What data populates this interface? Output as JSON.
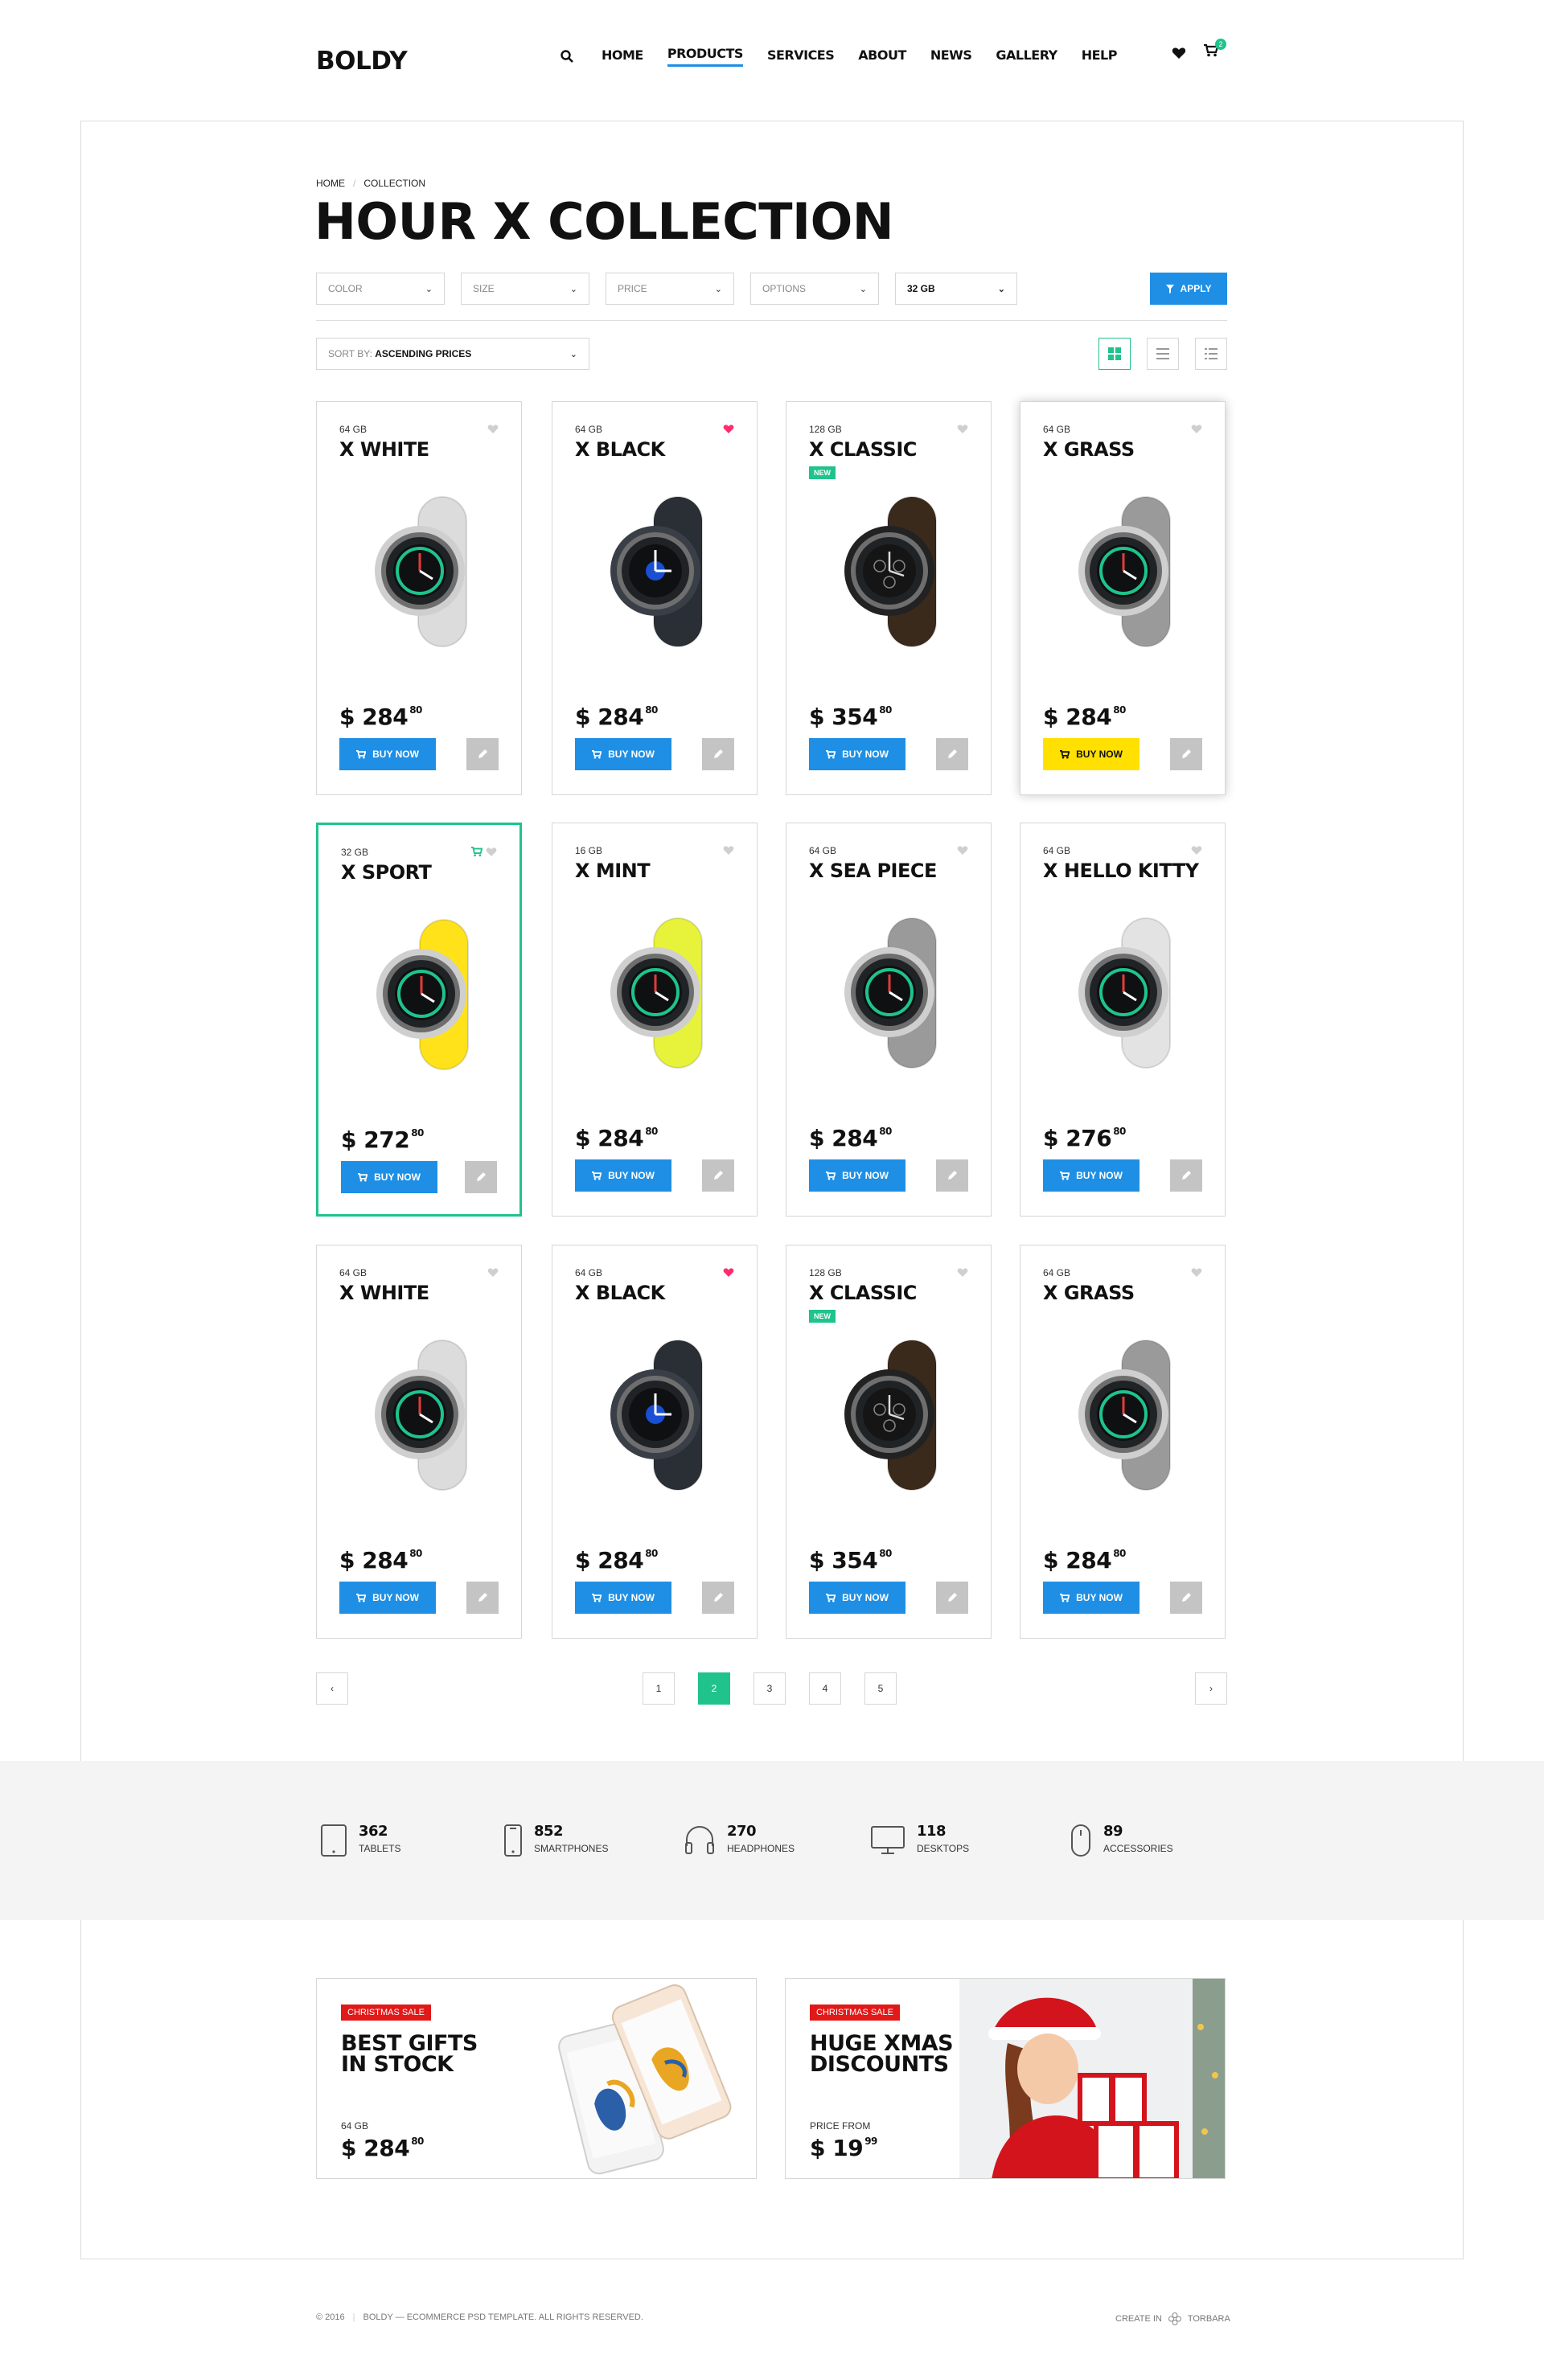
{
  "header": {
    "logo": "BOLDY",
    "nav": [
      "HOME",
      "PRODUCTS",
      "SERVICES",
      "ABOUT",
      "NEWS",
      "GALLERY",
      "HELP"
    ],
    "active_nav": "PRODUCTS",
    "cart_count": "2"
  },
  "breadcrumb": [
    "HOME",
    "COLLECTION"
  ],
  "page_title": "HOUR X COLLECTION",
  "filters": [
    "COLOR",
    "SIZE",
    "PRICE",
    "OPTIONS",
    "32 GB"
  ],
  "apply_label": "APPLY",
  "sort": {
    "label": "SORT BY:",
    "value": "ASCENDING PRICES"
  },
  "products": [
    {
      "gb": "64 GB",
      "name": "X WHITE",
      "price": "$ 284",
      "cents": "80",
      "liked": false,
      "new": false,
      "strap": "#dcdcdc",
      "case": "#cfcfcf",
      "face": "green"
    },
    {
      "gb": "64 GB",
      "name": "X BLACK",
      "price": "$ 284",
      "cents": "80",
      "liked": true,
      "new": false,
      "strap": "#2a2f36",
      "case": "#3a3f47",
      "face": "blue"
    },
    {
      "gb": "128 GB",
      "name": "X CLASSIC",
      "price": "$ 354",
      "cents": "80",
      "liked": false,
      "new": true,
      "strap": "#3a2a1c",
      "case": "#222222",
      "face": "classic"
    },
    {
      "gb": "64 GB",
      "name": "X GRASS",
      "price": "$ 284",
      "cents": "80",
      "liked": false,
      "new": false,
      "strap": "#9a9a9a",
      "case": "#cfcfcf",
      "face": "green"
    },
    {
      "gb": "32 GB",
      "name": "X SPORT",
      "price": "$ 272",
      "cents": "80",
      "liked": false,
      "new": false,
      "strap": "#ffe21a",
      "case": "#cfcfcf",
      "face": "green"
    },
    {
      "gb": "16 GB",
      "name": "X MINT",
      "price": "$ 284",
      "cents": "80",
      "liked": false,
      "new": false,
      "strap": "#e7f23a",
      "case": "#cfcfcf",
      "face": "green"
    },
    {
      "gb": "64 GB",
      "name": "X SEA PIECE",
      "price": "$ 284",
      "cents": "80",
      "liked": false,
      "new": false,
      "strap": "#9a9a9a",
      "case": "#cfcfcf",
      "face": "green"
    },
    {
      "gb": "64 GB",
      "name": "X HELLO KITTY",
      "price": "$ 276",
      "cents": "80",
      "liked": false,
      "new": false,
      "strap": "#e3e3e3",
      "case": "#cfcfcf",
      "face": "green"
    },
    {
      "gb": "64 GB",
      "name": "X WHITE",
      "price": "$ 284",
      "cents": "80",
      "liked": false,
      "new": false,
      "strap": "#dcdcdc",
      "case": "#cfcfcf",
      "face": "green"
    },
    {
      "gb": "64 GB",
      "name": "X BLACK",
      "price": "$ 284",
      "cents": "80",
      "liked": true,
      "new": false,
      "strap": "#2a2f36",
      "case": "#3a3f47",
      "face": "blue"
    },
    {
      "gb": "128 GB",
      "name": "X CLASSIC",
      "price": "$ 354",
      "cents": "80",
      "liked": false,
      "new": true,
      "strap": "#3a2a1c",
      "case": "#222222",
      "face": "classic"
    },
    {
      "gb": "64 GB",
      "name": "X GRASS",
      "price": "$ 284",
      "cents": "80",
      "liked": false,
      "new": false,
      "strap": "#9a9a9a",
      "case": "#cfcfcf",
      "face": "green"
    }
  ],
  "new_badge": "NEW",
  "buy_label": "BUY NOW",
  "pagination": {
    "pages": [
      "1",
      "2",
      "3",
      "4",
      "5"
    ],
    "current": "2"
  },
  "stats": [
    {
      "num": "362",
      "label": "TABLETS",
      "icon": "tablet-icon"
    },
    {
      "num": "852",
      "label": "SMARTPHONES",
      "icon": "smartphone-icon"
    },
    {
      "num": "270",
      "label": "HEADPHONES",
      "icon": "headphones-icon"
    },
    {
      "num": "118",
      "label": "DESKTOPS",
      "icon": "desktop-icon"
    },
    {
      "num": "89",
      "label": "ACCESSORIES",
      "icon": "mouse-icon"
    }
  ],
  "banners": [
    {
      "tag": "CHRISTMAS SALE",
      "title": "BEST GIFTS\nIN STOCK",
      "sub": "64 GB",
      "price": "$ 284",
      "cents": "80"
    },
    {
      "tag": "CHRISTMAS SALE",
      "title": "HUGE XMAS\nDISCOUNTS",
      "sub": "PRICE FROM",
      "price": "$ 19",
      "cents": "99"
    }
  ],
  "footer": {
    "copyright": "© 2016",
    "text": "BOLDY — ECOMMERCE PSD TEMPLATE. ALL RIGHTS RESERVED.",
    "created": "CREATE IN",
    "brand": "TORBARA"
  },
  "colors": {
    "accent_blue": "#1e8fe5",
    "accent_green": "#1fc38b",
    "like_pink": "#ff2d6d",
    "sale_red": "#e11919",
    "highlight_yellow": "#ffe000"
  }
}
